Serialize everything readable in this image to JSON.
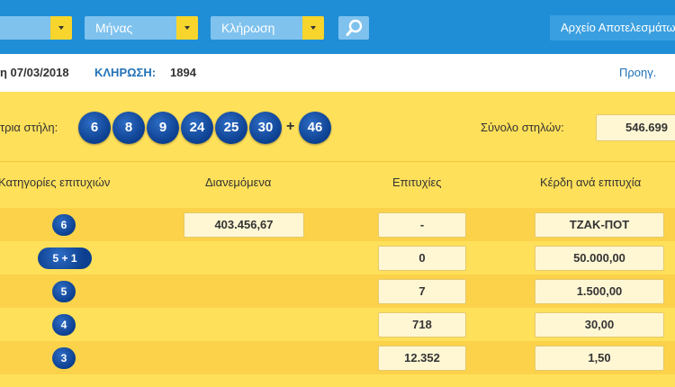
{
  "filters": {
    "year_value": "",
    "month_label": "Μήνας",
    "draw_label": "Κλήρωση",
    "archive_button": "Αρχείο Αποτελεσμάτων"
  },
  "info": {
    "date": "η 07/03/2018",
    "draw_label": "ΚΛΗΡΩΣΗ:",
    "draw_number": "1894",
    "prev_link": "Προηγ."
  },
  "winning": {
    "label": "τρια στήλη:",
    "numbers": [
      "6",
      "8",
      "9",
      "24",
      "25",
      "30"
    ],
    "plus": "+",
    "bonus": "46",
    "total_label": "Σύνολο στηλών:",
    "total_value": "546.699"
  },
  "table": {
    "headers": [
      "Κατηγορίες επιτυχιών",
      "Διανεμόμενα",
      "Επιτυχίες",
      "Κέρδη ανά επιτυχία"
    ],
    "rows": [
      {
        "category": "6",
        "distributed": "403.456,67",
        "winners": "-",
        "prize": "ΤΖΑΚ-ΠΟΤ"
      },
      {
        "category": "5 + 1",
        "distributed": "",
        "winners": "0",
        "prize": "50.000,00"
      },
      {
        "category": "5",
        "distributed": "",
        "winners": "7",
        "prize": "1.500,00"
      },
      {
        "category": "4",
        "distributed": "",
        "winners": "718",
        "prize": "30,00"
      },
      {
        "category": "3",
        "distributed": "",
        "winners": "12.352",
        "prize": "1,50"
      }
    ]
  },
  "colors": {
    "header_blue": "#1f8ed6",
    "panel_yellow": "#ffe05a",
    "ball_blue": "#0c3f8f",
    "link_blue": "#2372b8"
  },
  "icons": {
    "search": "magnifier-icon",
    "dropdown": "chevron-down-icon"
  }
}
